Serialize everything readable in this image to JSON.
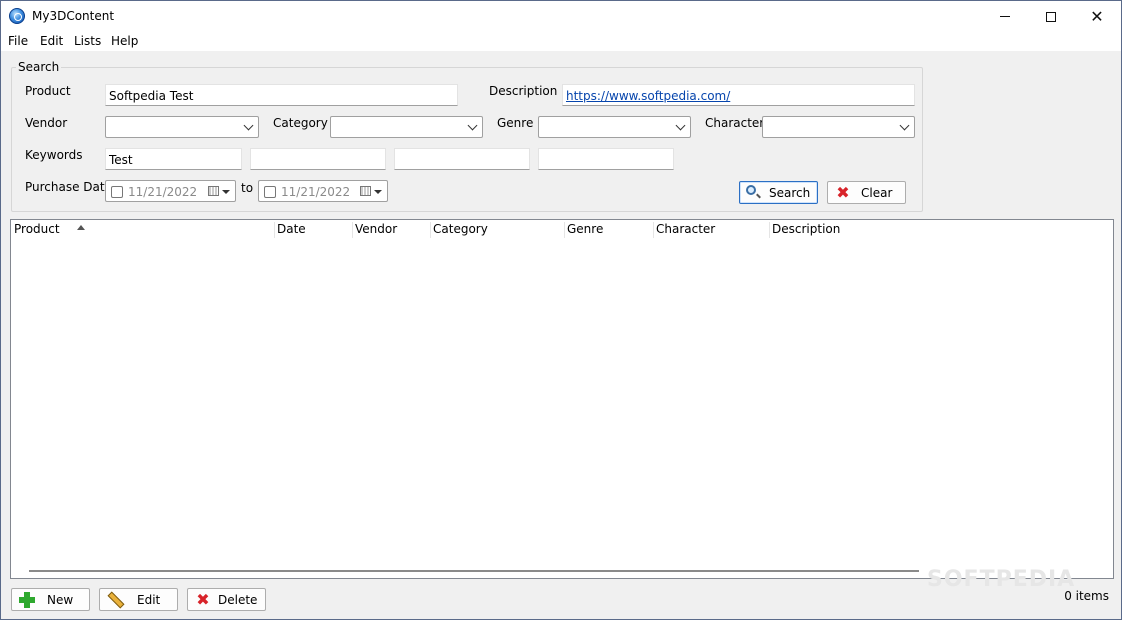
{
  "window": {
    "title": "My3DContent"
  },
  "menu": [
    "File",
    "Edit",
    "Lists",
    "Help"
  ],
  "search": {
    "legend": "Search",
    "product_label": "Product",
    "product_value": "Softpedia Test",
    "description_label": "Description",
    "description_value": "https://www.softpedia.com/",
    "vendor_label": "Vendor",
    "category_label": "Category",
    "genre_label": "Genre",
    "character_label": "Character",
    "keywords_label": "Keywords",
    "keywords": [
      "Test",
      "",
      "",
      ""
    ],
    "purchase_date_label": "Purchase Date",
    "to_label": "to",
    "date_from": "11/21/2022",
    "date_to": "11/21/2022",
    "search_button": "Search",
    "clear_button": "Clear"
  },
  "list": {
    "columns": [
      "Product",
      "Date",
      "Vendor",
      "Category",
      "Genre",
      "Character",
      "Description"
    ],
    "sort_column": "Product",
    "rows": []
  },
  "actions": {
    "new": "New",
    "edit": "Edit",
    "delete": "Delete"
  },
  "status": {
    "items": "0 items"
  },
  "watermark": "SOFTPEDIA"
}
